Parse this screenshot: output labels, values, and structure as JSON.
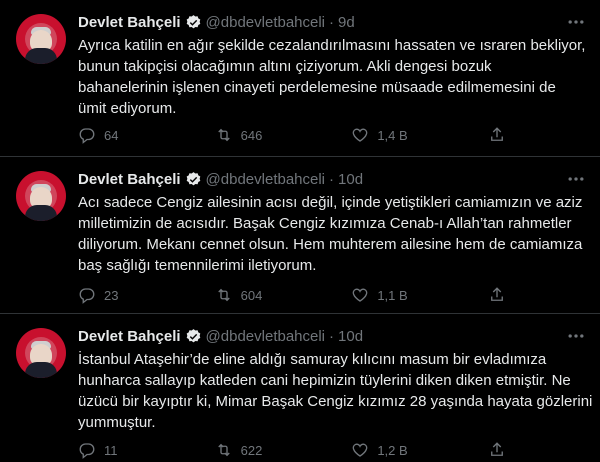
{
  "tweets": [
    {
      "name": "Devlet Bahçeli",
      "handle": "@dbdevletbahceli",
      "dot": "·",
      "time": "9d",
      "lines": [
        "Ayrıca katilin en ağır şekilde cezalandırılmasını hassaten ve ısraren bekliyor,",
        "bunun takipçisi olacağımın altını çiziyorum. Akli dengesi bozuk",
        "bahanelerinin işlenen cinayeti perdelemesine müsaade edilmemesini de",
        "ümit ediyorum."
      ],
      "replies": "64",
      "retweets": "646",
      "likes": "1,4 B",
      "share": ""
    },
    {
      "name": "Devlet Bahçeli",
      "handle": "@dbdevletbahceli",
      "dot": "·",
      "time": "10d",
      "lines": [
        "Acı sadece Cengiz ailesinin acısı değil, içinde yetiştikleri camiamızın ve aziz",
        "milletimizin de acısıdır. Başak Cengiz kızımıza Cenab-ı Allah’tan rahmetler",
        "diliyorum. Mekanı cennet olsun. Hem muhterem ailesine hem de camiamıza",
        "baş sağlığı temennilerimi iletiyorum."
      ],
      "replies": "23",
      "retweets": "604",
      "likes": "1,1 B",
      "share": ""
    },
    {
      "name": "Devlet Bahçeli",
      "handle": "@dbdevletbahceli",
      "dot": "·",
      "time": "10d",
      "lines": [
        "İstanbul Ataşehir’de eline aldığı samuray kılıcını masum bir evladımıza",
        "hunharca sallayıp katleden cani hepimizin tüylerini diken diken etmiştir. Ne",
        "üzücü bir kayıptır ki, Mimar Başak Cengiz kızımız 28 yaşında hayata gözlerini",
        "yummuştur."
      ],
      "replies": "11",
      "retweets": "622",
      "likes": "1,2 B",
      "share": ""
    }
  ],
  "icons": {
    "verified": "verified-badge-icon",
    "more": "more-options-icon",
    "reply": "reply-icon",
    "retweet": "retweet-icon",
    "like": "heart-icon",
    "share": "share-icon"
  },
  "colors": {
    "background": "#000000",
    "text": "#e7e9ea",
    "secondary": "#71767b",
    "verified": "#1d9bf0",
    "divider": "#2f3336"
  }
}
